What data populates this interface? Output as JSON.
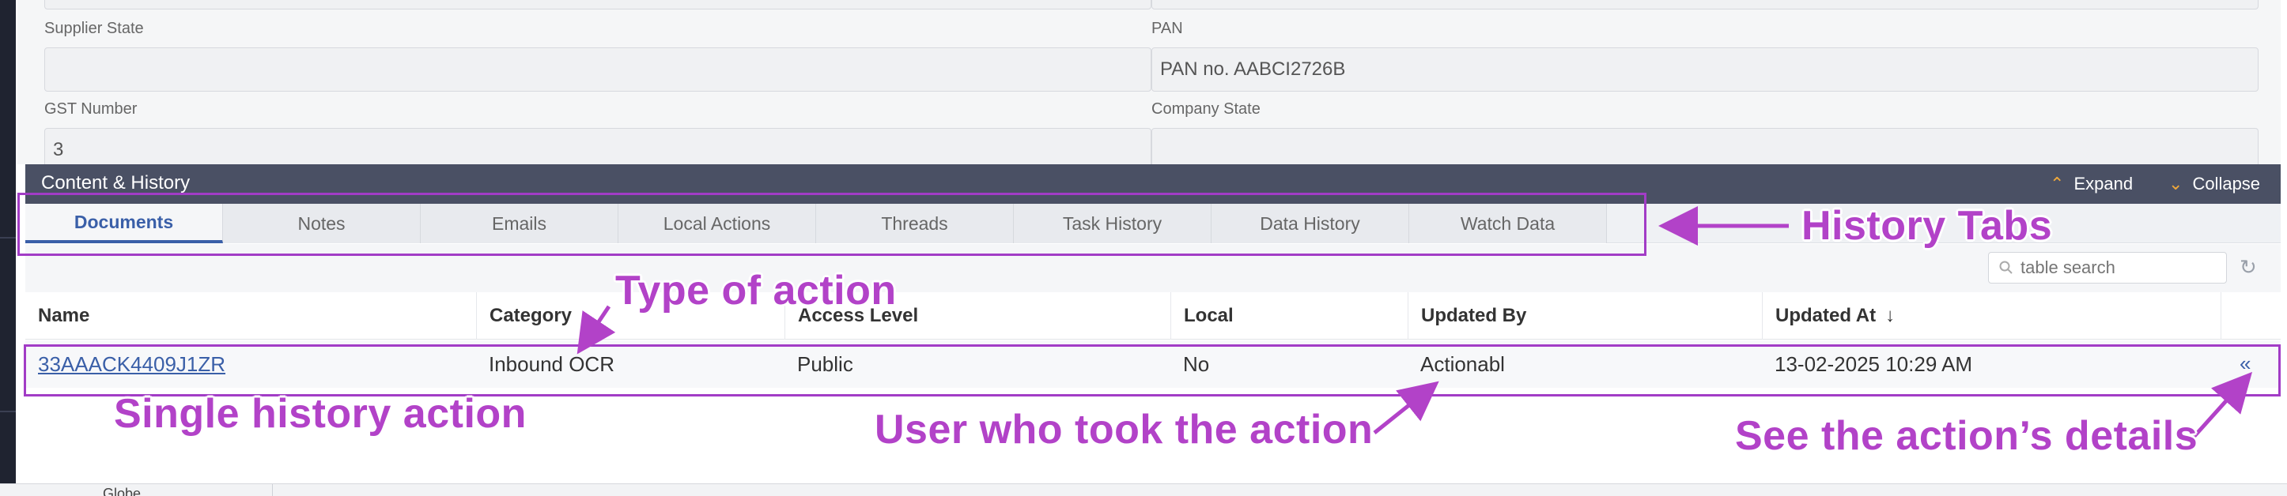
{
  "form": {
    "supplier_state_label": "Supplier State",
    "supplier_state_value": "",
    "pan_label": "PAN",
    "pan_value": "PAN no. AABCI2726B",
    "gst_label": "GST Number",
    "gst_value": "3",
    "company_state_label": "Company State",
    "company_state_value": ""
  },
  "section": {
    "title": "Content & History",
    "expand_label": "Expand",
    "collapse_label": "Collapse",
    "expand_icon": "chevron-up-icon",
    "collapse_icon": "chevron-down-icon"
  },
  "tabs": [
    {
      "label": "Documents",
      "active": true
    },
    {
      "label": "Notes"
    },
    {
      "label": "Emails"
    },
    {
      "label": "Local Actions"
    },
    {
      "label": "Threads"
    },
    {
      "label": "Task History"
    },
    {
      "label": "Data History"
    },
    {
      "label": "Watch Data"
    }
  ],
  "search": {
    "placeholder": "table search",
    "icon": "search-icon",
    "refresh_icon": "refresh-icon"
  },
  "table": {
    "columns": [
      "Name",
      "Category",
      "Access Level",
      "Local",
      "Updated By",
      "Updated At"
    ],
    "sort_indicator": "↓",
    "rows": [
      {
        "name": "33AAACK4409J1ZR",
        "category": "Inbound OCR",
        "access_level": "Public",
        "local": "No",
        "updated_by": "Actionabl",
        "updated_at": "13-02-2025 10:29 AM",
        "details_glyph": "«"
      }
    ]
  },
  "annotations": {
    "history_tabs": "History Tabs",
    "type_of_action": "Type of action",
    "single_history_action": "Single history  action",
    "user_who_took": "User who took the action",
    "see_details": "See the action’s details"
  },
  "colors": {
    "accent": "#3a5fa8",
    "annotation": "#b242c8",
    "header_bar": "#4a5064",
    "chevron": "#f0a83a"
  },
  "background": {
    "under_text": "Globe..."
  }
}
